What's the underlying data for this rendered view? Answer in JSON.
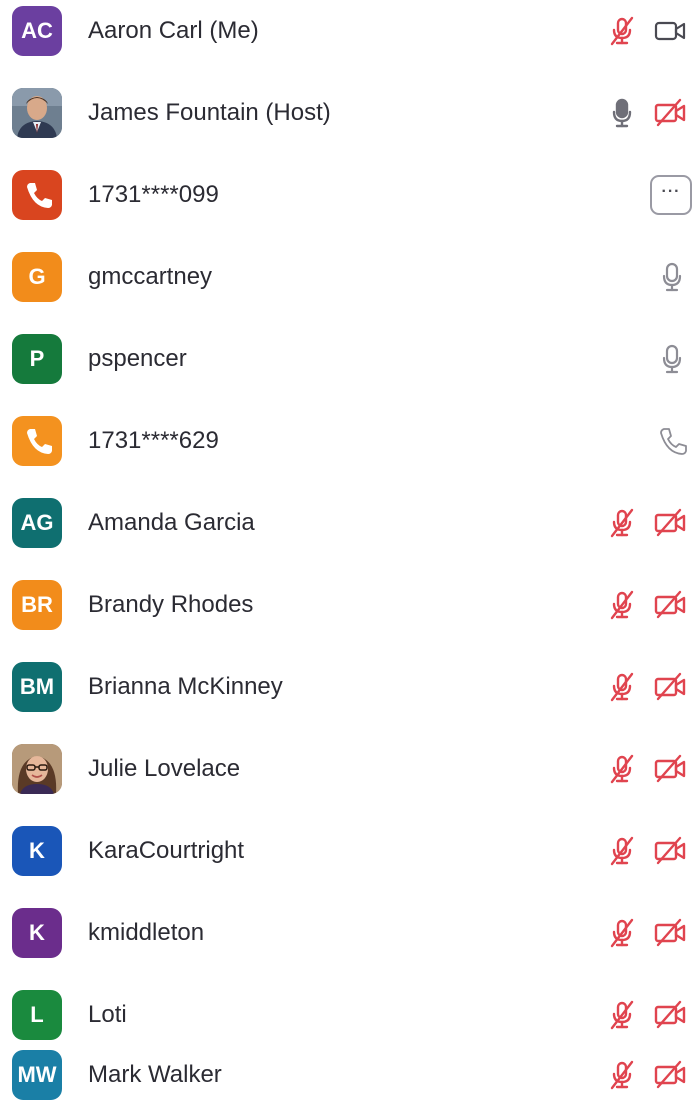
{
  "participants": [
    {
      "name": "Aaron Carl (Me)",
      "initials": "AC",
      "avatar_color": "#6b3fa0",
      "avatar_type": "initials",
      "mic": "muted",
      "video": "on"
    },
    {
      "name": "James Fountain (Host)",
      "initials": "",
      "avatar_color": "#5a6b7d",
      "avatar_type": "photo",
      "mic": "on",
      "video": "off"
    },
    {
      "name": "1731****099",
      "initials": "",
      "avatar_color": "#d9451f",
      "avatar_type": "phone",
      "action": "more-options"
    },
    {
      "name": "gmccartney",
      "initials": "G",
      "avatar_color": "#f28c1b",
      "avatar_type": "initials",
      "mic": "idle"
    },
    {
      "name": "pspencer",
      "initials": "P",
      "avatar_color": "#157a3c",
      "avatar_type": "initials",
      "mic": "idle"
    },
    {
      "name": "1731****629",
      "initials": "",
      "avatar_color": "#f4921f",
      "avatar_type": "phone",
      "status": "phone"
    },
    {
      "name": "Amanda Garcia",
      "initials": "AG",
      "avatar_color": "#0f6f70",
      "avatar_type": "initials",
      "mic": "muted",
      "video": "off"
    },
    {
      "name": "Brandy Rhodes",
      "initials": "BR",
      "avatar_color": "#f28c1b",
      "avatar_type": "initials",
      "mic": "muted",
      "video": "off"
    },
    {
      "name": "Brianna McKinney",
      "initials": "BM",
      "avatar_color": "#0f6f70",
      "avatar_type": "initials",
      "mic": "muted",
      "video": "off"
    },
    {
      "name": "Julie Lovelace",
      "initials": "",
      "avatar_color": "#8a6a4a",
      "avatar_type": "photo",
      "mic": "muted",
      "video": "off"
    },
    {
      "name": "KaraCourtright",
      "initials": "K",
      "avatar_color": "#1a56b8",
      "avatar_type": "initials",
      "mic": "muted",
      "video": "off"
    },
    {
      "name": "kmiddleton",
      "initials": "K",
      "avatar_color": "#6b2d8c",
      "avatar_type": "initials",
      "mic": "muted",
      "video": "off"
    },
    {
      "name": "Loti",
      "initials": "L",
      "avatar_color": "#1a8a3e",
      "avatar_type": "initials",
      "mic": "muted",
      "video": "off"
    },
    {
      "name": "Mark Walker",
      "initials": "MW",
      "avatar_color": "#1a7fa6",
      "avatar_type": "initials",
      "mic": "muted",
      "video": "off"
    }
  ],
  "more_options_label": "···",
  "colors": {
    "muted_red": "#e0444f",
    "icon_gray": "#8d8d95",
    "icon_dark": "#6f6f78",
    "name_text": "#2b2b33"
  }
}
